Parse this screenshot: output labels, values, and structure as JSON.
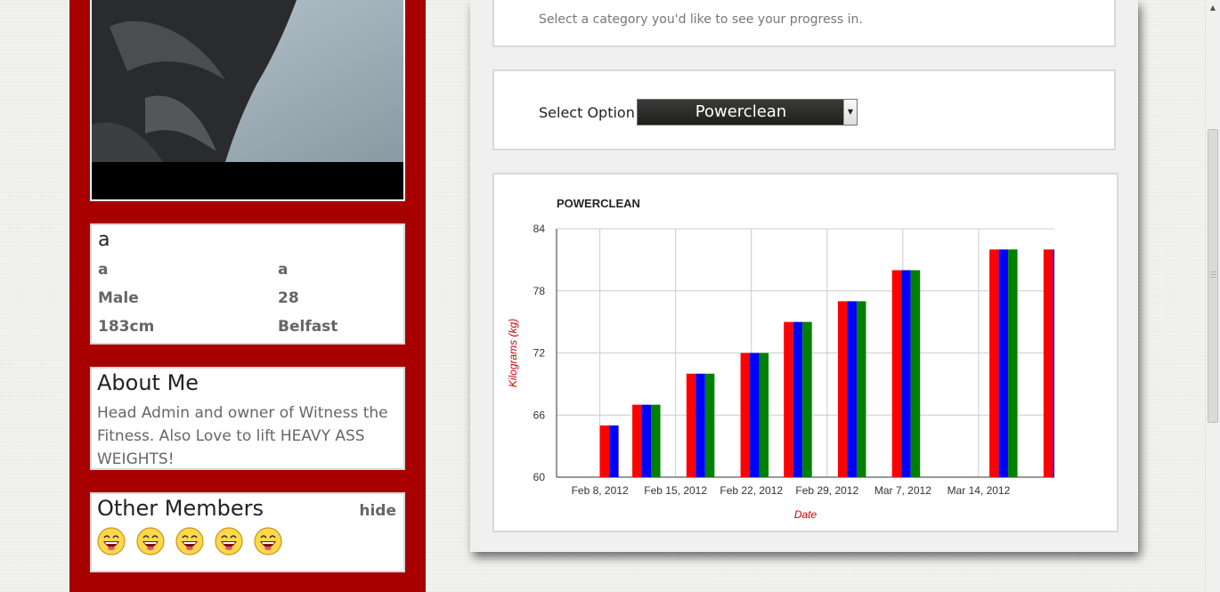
{
  "profile": {
    "name": "a",
    "first_name": "a",
    "last_name": "a",
    "gender": "Male",
    "age": "28",
    "height": "183cm",
    "city": "Belfast"
  },
  "about": {
    "heading": "About Me",
    "text": "Head Admin and owner of Witness the Fitness. Also Love to lift HEAVY ASS WEIGHTS!"
  },
  "members": {
    "heading": "Other Members",
    "hide_label": "hide",
    "avatar_icons": [
      "smiley-icon",
      "smiley-icon",
      "smiley-icon",
      "smiley-icon",
      "smiley-icon"
    ]
  },
  "category": {
    "hint": "Select a category you'd like to see your progress in."
  },
  "option": {
    "label": "Select Option",
    "selected": "Powerclean"
  },
  "colors": {
    "sidebar": "#a80000",
    "series": [
      "#ff0000",
      "#0000ff",
      "#008000"
    ]
  },
  "chart_data": {
    "type": "bar",
    "title": "POWERCLEAN",
    "xlabel": "Date",
    "ylabel": "Kilograms (kg)",
    "ylim": [
      60,
      84
    ],
    "yticks": [
      60,
      66,
      72,
      78,
      84
    ],
    "xticks": [
      "Feb 8, 2012",
      "Feb 15, 2012",
      "Feb 22, 2012",
      "Feb 29, 2012",
      "Mar 7, 2012",
      "Mar 14, 2012"
    ],
    "grid": true,
    "groups": [
      {
        "x": "Feb 8, 2012",
        "values": [
          65,
          65
        ]
      },
      {
        "x": "Feb 11, 2012",
        "values": [
          67,
          67,
          67
        ]
      },
      {
        "x": "Feb 16, 2012",
        "values": [
          70,
          70,
          70
        ]
      },
      {
        "x": "Feb 21, 2012",
        "values": [
          72,
          72,
          72
        ]
      },
      {
        "x": "Feb 25, 2012",
        "values": [
          75,
          75,
          75
        ]
      },
      {
        "x": "Mar 1, 2012",
        "values": [
          77,
          77,
          77
        ]
      },
      {
        "x": "Mar 6, 2012",
        "values": [
          80,
          80,
          80
        ]
      },
      {
        "x": "Mar 15, 2012",
        "values": [
          82,
          82,
          82
        ]
      },
      {
        "x": "Mar 20, 2012",
        "values": [
          82,
          82
        ]
      }
    ]
  }
}
